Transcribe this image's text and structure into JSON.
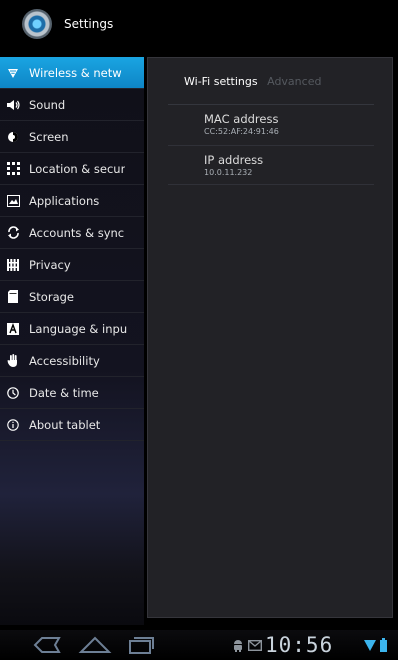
{
  "app": {
    "title": "Settings"
  },
  "sidebar": {
    "items": [
      {
        "label": "Wireless & netw",
        "icon": "wifi-icon",
        "active": true
      },
      {
        "label": "Sound",
        "icon": "speaker-icon"
      },
      {
        "label": "Screen",
        "icon": "screen-icon"
      },
      {
        "label": "Location & secur",
        "icon": "location-grid-icon"
      },
      {
        "label": "Applications",
        "icon": "applications-icon"
      },
      {
        "label": "Accounts & sync",
        "icon": "sync-icon"
      },
      {
        "label": "Privacy",
        "icon": "privacy-icon"
      },
      {
        "label": "Storage",
        "icon": "storage-icon"
      },
      {
        "label": "Language & inpu",
        "icon": "language-icon"
      },
      {
        "label": "Accessibility",
        "icon": "hand-icon"
      },
      {
        "label": "Date & time",
        "icon": "clock-icon"
      },
      {
        "label": "About tablet",
        "icon": "info-icon"
      }
    ]
  },
  "main": {
    "tabs": [
      {
        "label": "Wi-Fi settings",
        "active": true
      },
      {
        "label": "Advanced",
        "active": false
      }
    ],
    "preferences": [
      {
        "label": "MAC address",
        "value": "CC:52:AF:24:91:46"
      },
      {
        "label": "IP address",
        "value": "10.0.11.232"
      }
    ]
  },
  "statusbar": {
    "time": "10:56",
    "icons": [
      "android-debug-icon",
      "gmail-icon",
      "wifi-signal-icon",
      "battery-icon"
    ]
  },
  "navbar": {
    "buttons": [
      "back-button",
      "home-button",
      "recent-apps-button"
    ]
  },
  "colors": {
    "accent": "#1597d6",
    "panel": "#222226",
    "background": "#000000"
  }
}
